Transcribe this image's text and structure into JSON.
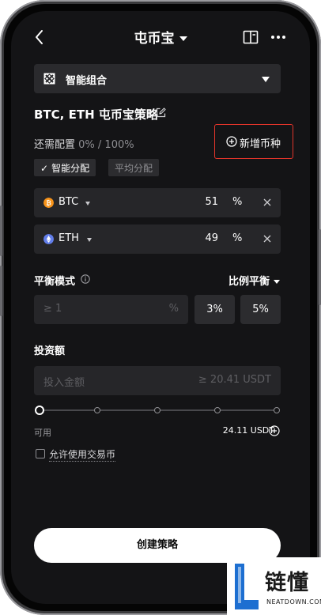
{
  "header": {
    "title": "屯币宝"
  },
  "portfolio_selector": {
    "label": "智能组合"
  },
  "strategy": {
    "title": "BTC, ETH 屯币宝策略"
  },
  "allocation": {
    "remaining_label": "还需配置",
    "remaining_value": "0% / 100%",
    "add_coin_label": "新增币种",
    "smart_label": "智能分配",
    "even_label": "平均分配"
  },
  "coins": [
    {
      "name": "BTC",
      "percent": "51",
      "unit": "%",
      "color": "#f7931a"
    },
    {
      "name": "ETH",
      "percent": "49",
      "unit": "%",
      "color": "#627eea"
    }
  ],
  "balance": {
    "label": "平衡模式",
    "mode": "比例平衡",
    "threshold_placeholder": "≥ 1",
    "threshold_unit": "%",
    "presets": [
      "3%",
      "5%"
    ]
  },
  "investment": {
    "label": "投资额",
    "placeholder": "投入金额",
    "minimum": "≥ 20.41 USDT",
    "slider_fraction": 0,
    "available_label": "可用",
    "available_value": "24.11 USDT"
  },
  "trade_coin": {
    "label": "允许使用交易币",
    "checked": false
  },
  "create_button": {
    "label": "创建策略"
  },
  "watermark": {
    "text": "链懂",
    "sub": "NEATDOWN.COM"
  },
  "colors": {
    "background": "#141416",
    "card": "#262629",
    "highlight_border": "#e0342a",
    "btc": "#f7931a",
    "eth": "#627eea",
    "watermark_blue": "#1d6fd1"
  }
}
